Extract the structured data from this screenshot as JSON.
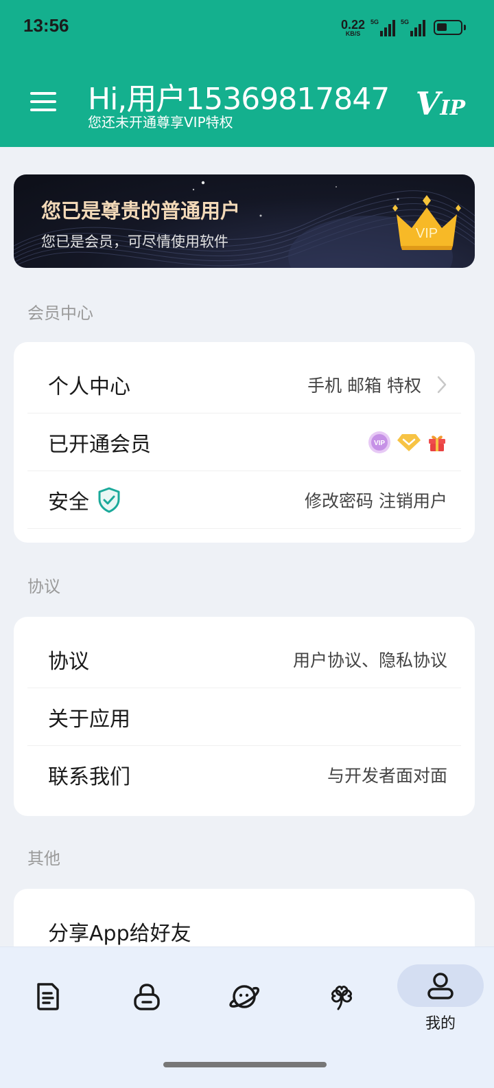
{
  "status_bar": {
    "time": "13:56",
    "net_speed_value": "0.22",
    "net_speed_unit": "KB/S",
    "signal1_label": "5G",
    "signal2_label": "5G",
    "battery_level": 0.45
  },
  "header": {
    "greeting": "Hi,用户15369817847",
    "subtitle": "您还未开通尊享VIP特权",
    "vip_logo_v": "V",
    "vip_logo_ip": "IP"
  },
  "banner": {
    "title": "您已是尊贵的普通用户",
    "subtitle": "您已是会员，可尽情使用软件",
    "crown_text": "VIP"
  },
  "sections": {
    "member_center": {
      "label": "会员中心",
      "rows": [
        {
          "label": "个人中心",
          "value": "手机 邮箱 特权"
        },
        {
          "label": "已开通会员",
          "value": ""
        },
        {
          "label": "安全",
          "value": "修改密码  注销用户"
        }
      ]
    },
    "agreement": {
      "label": "协议",
      "rows": [
        {
          "label": "协议",
          "value": "用户协议、隐私协议"
        },
        {
          "label": "关于应用",
          "value": ""
        },
        {
          "label": "联系我们",
          "value": "与开发者面对面"
        }
      ]
    },
    "other": {
      "label": "其他",
      "rows": [
        {
          "label": "分享App给好友",
          "value": ""
        }
      ]
    }
  },
  "member_badges": [
    "vip-badge",
    "diamond-badge",
    "gift-badge"
  ],
  "badge_text": "VIP",
  "bottom_nav": {
    "items": [
      {
        "icon": "document-icon",
        "label": ""
      },
      {
        "icon": "lock-icon",
        "label": ""
      },
      {
        "icon": "planet-icon",
        "label": ""
      },
      {
        "icon": "clover-icon",
        "label": ""
      },
      {
        "icon": "user-icon",
        "label": "我的"
      }
    ],
    "active_index": 4
  },
  "colors": {
    "header_bg": "#14b08e",
    "banner_title": "#f3d9b8",
    "nav_bg": "#e9f0fb",
    "nav_active_pill": "#d4def2",
    "shield_teal": "#1aa99a"
  }
}
